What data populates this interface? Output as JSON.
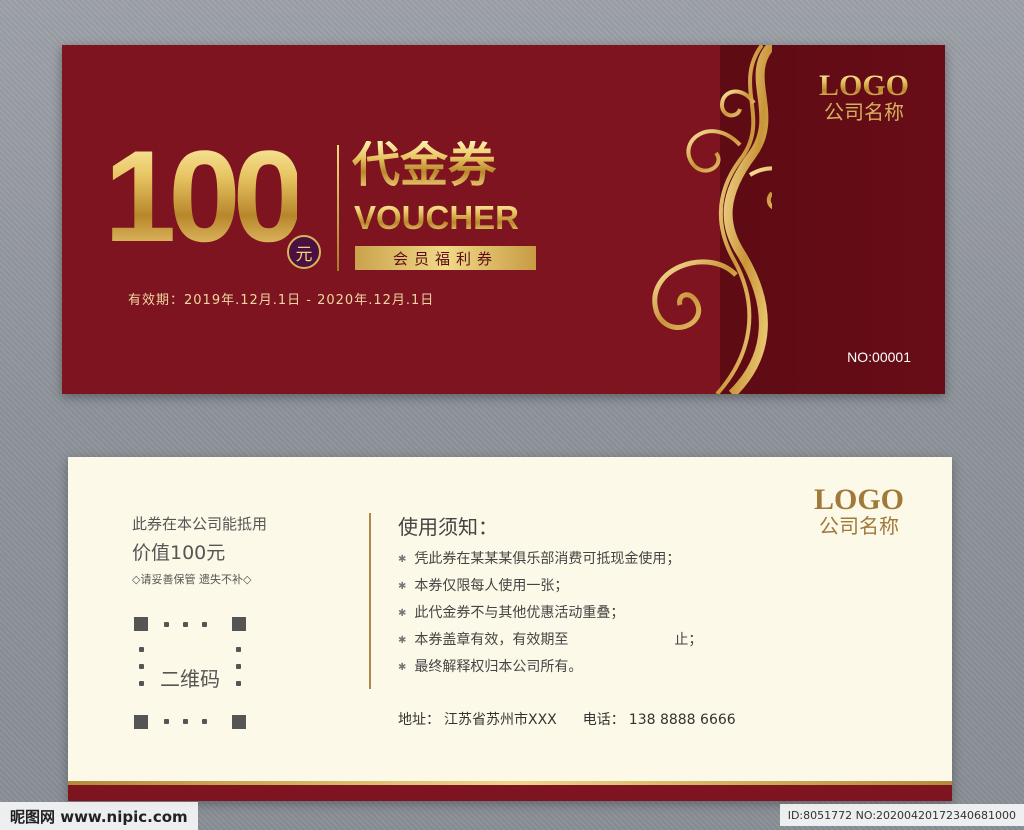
{
  "front": {
    "amount": "100",
    "currency": "元",
    "title_cn": "代金券",
    "title_en": "VOUCHER",
    "member_label": "会员福利券",
    "validity": "有效期：2019年.12月.1日 - 2020年.12月.1日",
    "logo": "LOGO",
    "company": "公司名称",
    "serial": "NO:00001",
    "colors": {
      "background": "#7d1420",
      "gold": "#d4af5c"
    }
  },
  "back": {
    "left": {
      "line1": "此券在本公司能抵用",
      "line2": "价值100元",
      "line3": "◇请妥善保管 遗失不补◇",
      "qr_label": "二维码"
    },
    "notes": {
      "heading": "使用须知：",
      "items": [
        "凭此券在某某某俱乐部消费可抵现金使用；",
        "本券仅限每人使用一张；",
        "此代金券不与其他优惠活动重叠；",
        "本券盖章有效，有效期至",
        "最终解释权归本公司所有。"
      ],
      "item4_suffix": "止；"
    },
    "address_label": "地址：",
    "address": "江苏省苏州市XXX",
    "phone_label": "电话：",
    "phone": "138 8888 6666",
    "logo": "LOGO",
    "company": "公司名称"
  },
  "watermark": {
    "site": "昵图网 www.nipic.com",
    "id": "ID:8051772 NO:20200420172340681000"
  }
}
